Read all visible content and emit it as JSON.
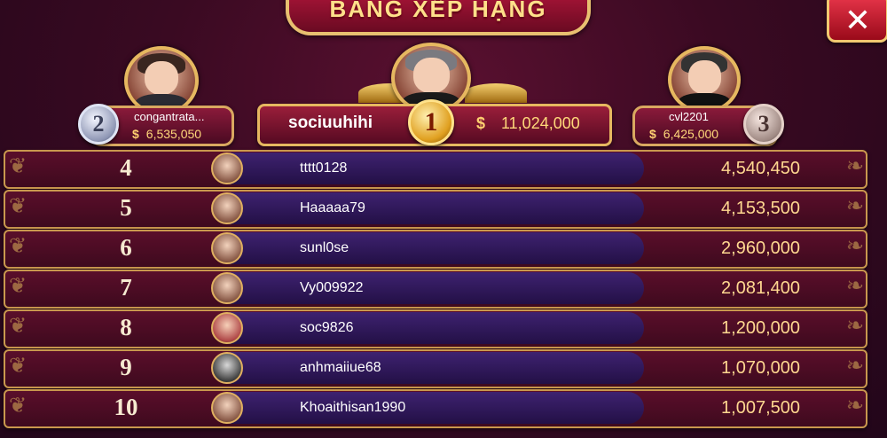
{
  "header": {
    "title": "BẢNG XẾP HẠNG",
    "close_label": "✕"
  },
  "podium": {
    "first": {
      "rank": "1",
      "name": "sociuuhihi",
      "currency": "$",
      "amount": "11,024,000"
    },
    "second": {
      "rank": "2",
      "name": "congantrata...",
      "currency": "$",
      "amount": "6,535,050"
    },
    "third": {
      "rank": "3",
      "name": "cvl2201",
      "currency": "$",
      "amount": "6,425,000"
    }
  },
  "rows": [
    {
      "rank": "4",
      "name": "tttt0128",
      "score": "4,540,450"
    },
    {
      "rank": "5",
      "name": "Haaaaa79",
      "score": "4,153,500"
    },
    {
      "rank": "6",
      "name": "sunl0se",
      "score": "2,960,000"
    },
    {
      "rank": "7",
      "name": "Vy009922",
      "score": "2,081,400"
    },
    {
      "rank": "8",
      "name": "soc9826",
      "score": "1,200,000"
    },
    {
      "rank": "9",
      "name": "anhmaiiue68",
      "score": "1,070,000"
    },
    {
      "rank": "10",
      "name": "Khoaithisan1990",
      "score": "1,007,500"
    }
  ],
  "colors": {
    "accent_gold": "#e6b860",
    "row_bg": "#4a0c24",
    "name_bar": "#2e1658"
  }
}
